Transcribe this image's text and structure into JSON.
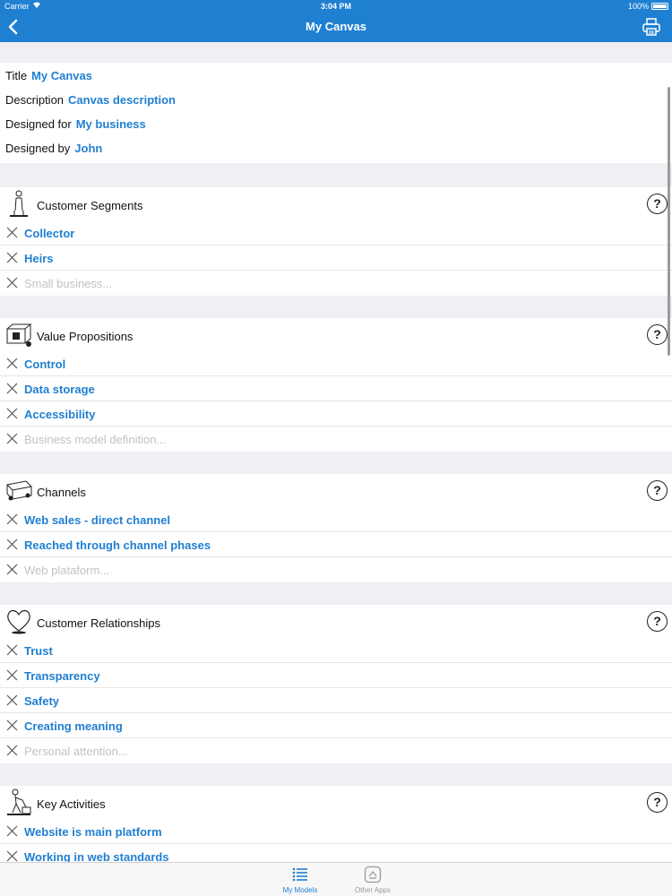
{
  "status_bar": {
    "carrier": "Carrier",
    "time": "3:04 PM",
    "battery": "100%"
  },
  "nav": {
    "title": "My Canvas",
    "back_icon": "chevron-left-icon",
    "print_icon": "printer-icon"
  },
  "info": [
    {
      "label": "Title",
      "value": "My Canvas"
    },
    {
      "label": "Description",
      "value": "Canvas description"
    },
    {
      "label": "Designed for",
      "value": "My business"
    },
    {
      "label": "Designed by",
      "value": "John"
    }
  ],
  "sections": [
    {
      "title": "Customer Segments",
      "icon": "person-icon",
      "items": [
        "Collector",
        "Heirs"
      ],
      "placeholder": "Small business..."
    },
    {
      "title": "Value Propositions",
      "icon": "gift-icon",
      "items": [
        "Control",
        "Data storage",
        "Accessibility"
      ],
      "placeholder": "Business model definition..."
    },
    {
      "title": "Channels",
      "icon": "truck-icon",
      "items": [
        "Web sales - direct channel",
        "Reached through channel phases"
      ],
      "placeholder": "Web plataform..."
    },
    {
      "title": "Customer Relationships",
      "icon": "heart-icon",
      "items": [
        "Trust",
        "Transparency",
        "Safety",
        "Creating meaning"
      ],
      "placeholder": "Personal attention..."
    },
    {
      "title": "Key Activities",
      "icon": "worker-icon",
      "items": [
        "Website is main platform",
        "Working in web standards"
      ],
      "placeholder": ""
    }
  ],
  "help_label": "?",
  "tabs": [
    {
      "label": "My Models",
      "icon": "list-icon",
      "active": true
    },
    {
      "label": "Other Apps",
      "icon": "apps-icon",
      "active": false
    }
  ],
  "colors": {
    "accent": "#1f80d2",
    "link": "#1f7fd1",
    "placeholder": "#c2c2c7",
    "background": "#efeff4"
  }
}
